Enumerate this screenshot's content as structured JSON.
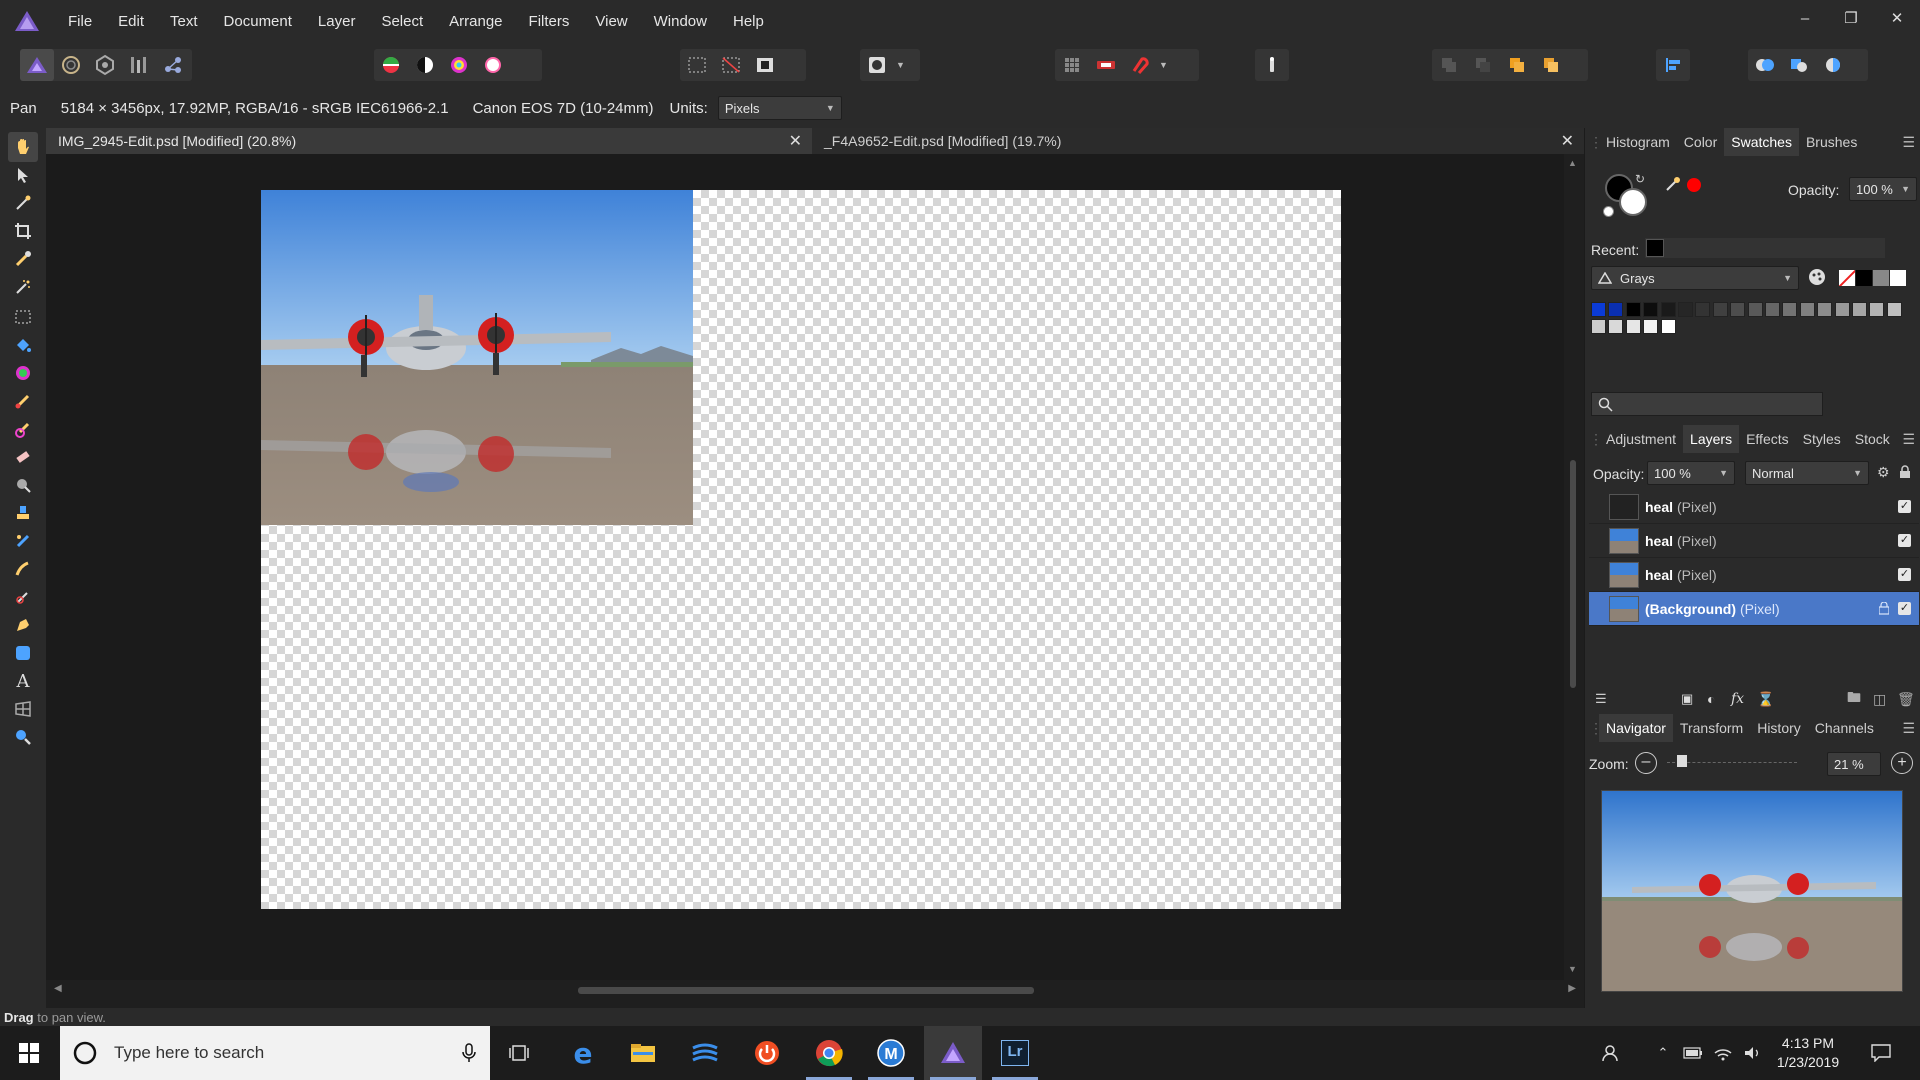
{
  "menubar": {
    "items": [
      "File",
      "Edit",
      "Text",
      "Document",
      "Layer",
      "Select",
      "Arrange",
      "Filters",
      "View",
      "Window",
      "Help"
    ]
  },
  "contextbar": {
    "tool_name": "Pan",
    "image_info": "5184 × 3456px, 17.92MP, RGBA/16 - sRGB IEC61966-2.1",
    "camera": "Canon EOS 7D (10-24mm)",
    "units_label": "Units:",
    "units_value": "Pixels"
  },
  "tabs": [
    {
      "label": "IMG_2945-Edit.psd [Modified] (20.8%)",
      "active": true
    },
    {
      "label": "_F4A9652-Edit.psd [Modified] (19.7%)",
      "active": false
    }
  ],
  "swatches_panel": {
    "tabs": [
      "Histogram",
      "Color",
      "Swatches",
      "Brushes"
    ],
    "active_tab": "Swatches",
    "opacity_label": "Opacity:",
    "opacity_value": "100 %",
    "recent_label": "Recent:",
    "palette_name": "Grays",
    "accent_colors": {
      "primary": "#000000",
      "secondary": "#ffffff",
      "highlight": "#ff0000"
    }
  },
  "layers_panel": {
    "tabs": [
      "Adjustment",
      "Layers",
      "Effects",
      "Styles",
      "Stock"
    ],
    "active_tab": "Layers",
    "opacity_label": "Opacity:",
    "opacity_value": "100 %",
    "blend_mode": "Normal",
    "layers": [
      {
        "name": "heal",
        "type": "(Pixel)"
      },
      {
        "name": "heal",
        "type": "(Pixel)"
      },
      {
        "name": "heal",
        "type": "(Pixel)"
      },
      {
        "name": "(Background)",
        "type": "(Pixel)"
      }
    ]
  },
  "navigator_panel": {
    "tabs": [
      "Navigator",
      "Transform",
      "History",
      "Channels"
    ],
    "active_tab": "Navigator",
    "zoom_label": "Zoom:",
    "zoom_value": "21 %"
  },
  "status": {
    "bold": "Drag",
    "text": " to pan view."
  },
  "taskbar": {
    "search_placeholder": "Type here to search",
    "time": "4:13 PM",
    "date": "1/23/2019"
  }
}
